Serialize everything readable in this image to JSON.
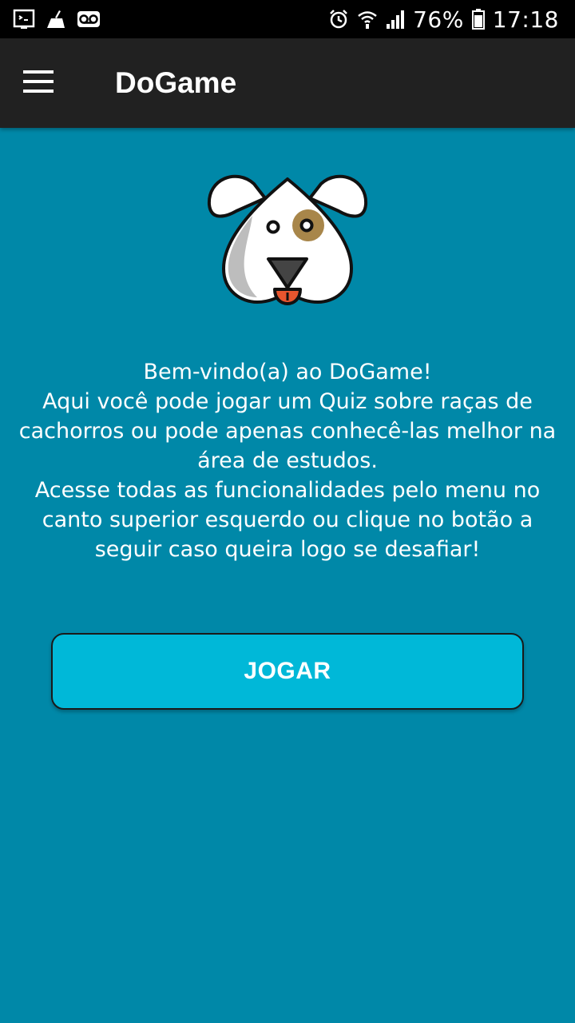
{
  "status_bar": {
    "left_icons": [
      "screenshot-icon",
      "cleaner-icon",
      "voicemail-icon"
    ],
    "right_icons": [
      "alarm-icon",
      "wifi-icon",
      "signal-icon",
      "battery-icon"
    ],
    "battery": "76%",
    "time": "17:18"
  },
  "app_bar": {
    "menu_icon": "hamburger-menu-icon",
    "title": "DoGame"
  },
  "main": {
    "logo_icon": "dog-face-logo",
    "welcome_lines": [
      "Bem-vindo(a) ao DoGame!",
      "Aqui você pode jogar um Quiz sobre raças de cachorros ou pode apenas conhecê-las melhor na área de estudos.",
      "Acesse todas as funcionalidades pelo menu no canto superior esquerdo ou clique no botão a seguir caso queira logo se desafiar!"
    ],
    "play_button": "JOGAR"
  },
  "colors": {
    "background": "#0088a8",
    "app_bar": "#212121",
    "status_bar": "#000000",
    "button": "#00b8d8",
    "text": "#ffffff"
  }
}
